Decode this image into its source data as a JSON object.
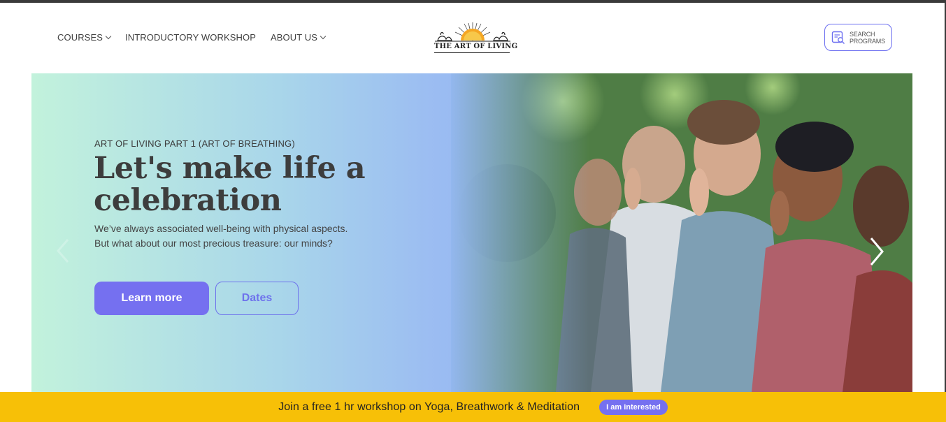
{
  "header": {
    "nav": [
      {
        "label": "COURSES",
        "has_dropdown": true
      },
      {
        "label": "INTRODUCTORY WORKSHOP",
        "has_dropdown": false
      },
      {
        "label": "ABOUT US",
        "has_dropdown": true
      }
    ],
    "logo_text": "THE ART OF LIVING",
    "search_label": "SEARCH\nPROGRAMS"
  },
  "hero": {
    "kicker": "ART OF LIVING PART 1 (ART OF BREATHING)",
    "headline": "Let's make life a celebration",
    "subcopy": "We’ve always associated well-being with physical aspects. But what about our most precious treasure: our minds?",
    "primary_button": "Learn more",
    "secondary_button": "Dates"
  },
  "banner": {
    "text": "Join a free 1 hr workshop on Yoga, Breathwork & Meditation",
    "button": "I am interested"
  },
  "colors": {
    "accent": "#7570f0",
    "banner_bg": "#f7c007",
    "logo_sun": "#f5a623"
  }
}
